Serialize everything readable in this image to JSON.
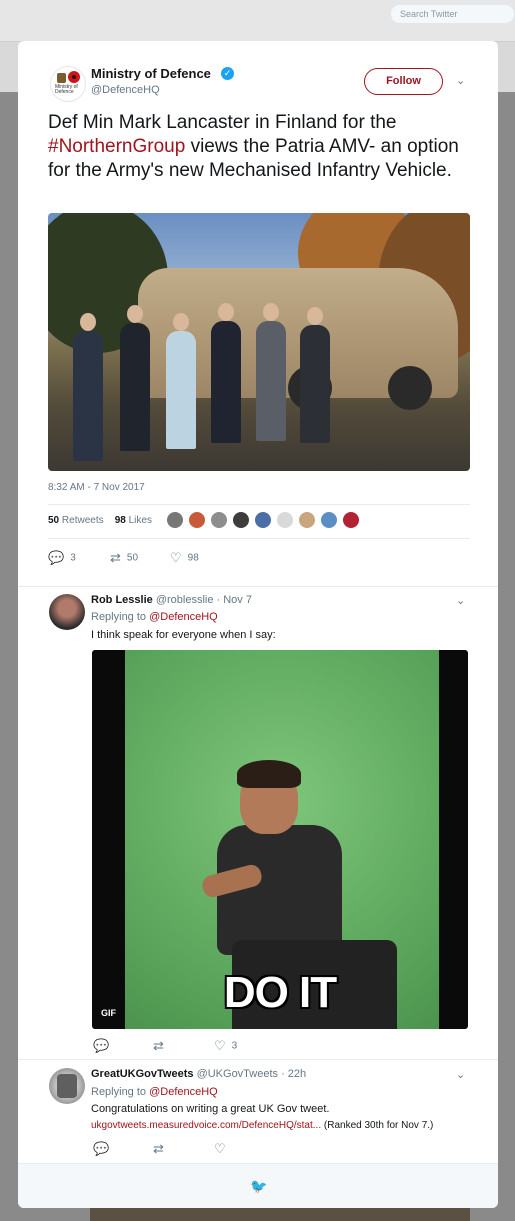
{
  "browser": {
    "search_placeholder": "Search Twitter"
  },
  "main_tweet": {
    "author_name": "Ministry of Defence",
    "author_handle": "@DefenceHQ",
    "avatar_text": "Ministry of Defence",
    "follow_label": "Follow",
    "text_before": "Def Min Mark Lancaster in Finland for the ",
    "hashtag": "#NorthernGroup",
    "text_after": " views the Patria AMV- an option for the Army's new Mechanised Infantry Vehicle.",
    "timestamp": "8:32 AM - 7 Nov 2017",
    "retweets_count": "50",
    "retweets_label": "Retweets",
    "likes_count": "98",
    "likes_label": "Likes",
    "replies": "3",
    "retweets": "50",
    "likes": "98"
  },
  "replies": [
    {
      "name": "Rob Lesslie",
      "handle": "@roblesslie · Nov 7",
      "replying_prefix": "Replying to ",
      "replying_to": "@DefenceHQ",
      "text": "I think speak for everyone when I say:",
      "gif_caption": "DO IT",
      "gif_badge": "GIF",
      "likes": "3"
    },
    {
      "name": "GreatUKGovTweets",
      "handle": "@UKGovTweets · 22h",
      "replying_prefix": "Replying to ",
      "replying_to": "@DefenceHQ",
      "text": "Congratulations on writing a great UK Gov tweet.",
      "link": "ukgovtweets.measuredvoice.com/DefenceHQ/stat...",
      "link_suffix": " (Ranked 30th for Nov 7.)"
    }
  ],
  "icons": {
    "reply": "reply-icon",
    "retweet": "retweet-icon",
    "like": "heart-icon",
    "caret": "chevron-down-icon",
    "twitter": "twitter-bird-icon"
  },
  "colors": {
    "brand": "#a0141e",
    "verified": "#1da1f2"
  }
}
